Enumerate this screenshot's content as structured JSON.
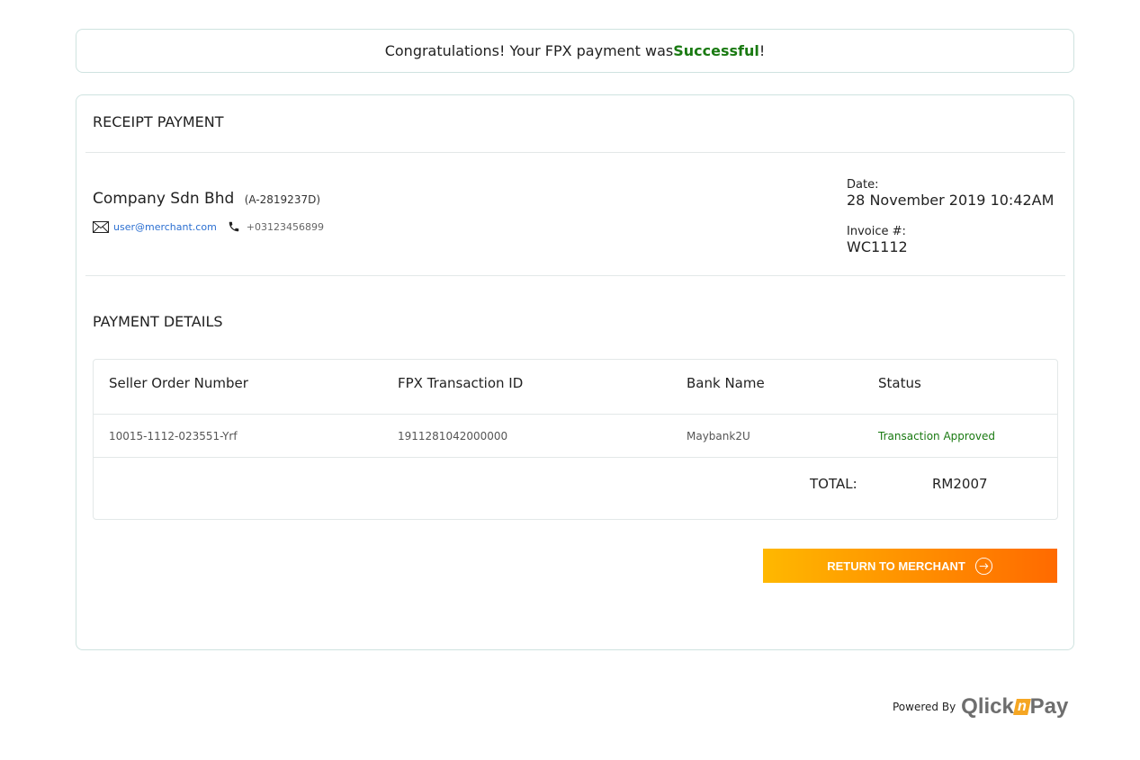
{
  "banner": {
    "prefix": "Congratulations! Your FPX payment was ",
    "status": "Successful",
    "suffix": "!"
  },
  "receipt": {
    "title": "RECEIPT PAYMENT",
    "company_name": "Company Sdn Bhd",
    "company_reg": "(A-2819237D)",
    "email": "user@merchant.com",
    "phone": "+03123456899",
    "date_label": "Date:",
    "date_value": "28 November 2019 10:42AM",
    "invoice_label": "Invoice #:",
    "invoice_value": "WC1112"
  },
  "payment_details": {
    "title": "PAYMENT DETAILS",
    "columns": [
      "Seller Order Number",
      "FPX Transaction ID",
      "Bank Name",
      "Status"
    ],
    "rows": [
      [
        "10015-1112-023551-Yrf",
        "1911281042000000",
        "Maybank2U",
        "Transaction Approved"
      ]
    ],
    "total_label": "TOTAL:",
    "total_value": "RM2007"
  },
  "actions": {
    "return_label": "RETURN TO MERCHANT"
  },
  "footer": {
    "powered_by": "Powered By",
    "logo_part1": "Qlick",
    "logo_n": "n",
    "logo_part2": "Pay"
  },
  "colors": {
    "success": "#1a7a12",
    "link": "#2b6fd1",
    "button_start": "#ffb800",
    "button_end": "#ff6a00"
  }
}
